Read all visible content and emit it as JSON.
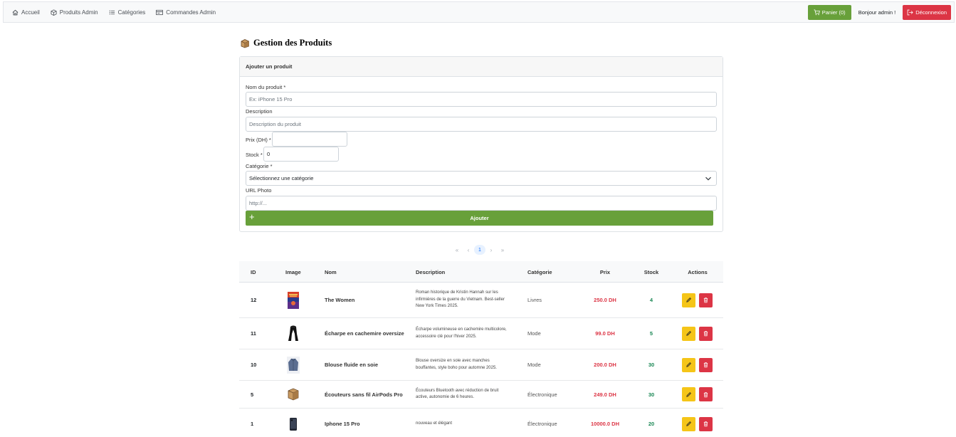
{
  "nav": {
    "home": "Accueil",
    "products_admin": "Produits Admin",
    "categories": "Catégories",
    "orders_admin": "Commandes Admin",
    "cart": "Panier (0)",
    "greeting": "Bonjour admin !",
    "logout": "Déconnexion"
  },
  "page": {
    "title": "Gestion des Produits"
  },
  "form": {
    "header": "Ajouter un produit",
    "name_label": "Nom du produit *",
    "name_placeholder": "Ex: iPhone 15 Pro",
    "desc_label": "Description",
    "desc_placeholder": "Description du produit",
    "price_label": "Prix (DH) *",
    "price_value": "",
    "stock_label": "Stock *",
    "stock_value": "0",
    "category_label": "Catégorie *",
    "category_selected": "Sélectionnez une catégorie",
    "photo_label": "URL Photo",
    "photo_placeholder": "http://...",
    "add_button": "Ajouter",
    "add_icon": "+"
  },
  "pagination": {
    "first": "«",
    "prev": "‹",
    "current": "1",
    "next": "›",
    "last": "»"
  },
  "table": {
    "headers": {
      "id": "ID",
      "image": "Image",
      "name": "Nom",
      "description": "Description",
      "category": "Catégorie",
      "price": "Prix",
      "stock": "Stock",
      "actions": "Actions"
    },
    "rows": [
      {
        "id": "12",
        "image_icon": "book-cover-icon",
        "name": "The Women",
        "description": "Roman historique de Kristin Hannah sur les infirmières de la guerre du Vietnam. Best-seller New York Times 2025.",
        "category": "Livres",
        "price": "250.0 DH",
        "stock": "4"
      },
      {
        "id": "11",
        "image_icon": "scarf-icon",
        "name": "Écharpe en cachemire oversize",
        "description": "Écharpe volumineuse en cachemire multicolore, accessoire clé pour l'hiver 2025.",
        "category": "Mode",
        "price": "99.0 DH",
        "stock": "5"
      },
      {
        "id": "10",
        "image_icon": "blouse-icon",
        "name": "Blouse fluide en soie",
        "description": "Blouse oversize en soie avec manches bouffantes, style boho pour automne 2025.",
        "category": "Mode",
        "price": "200.0 DH",
        "stock": "30"
      },
      {
        "id": "5",
        "image_icon": "box-icon",
        "name": "Écouteurs sans fil AirPods Pro",
        "description": "Écouteurs Bluetooth avec réduction de bruit active, autonomie de 6 heures.",
        "category": "Électronique",
        "price": "249.0 DH",
        "stock": "30"
      },
      {
        "id": "1",
        "image_icon": "phone-icon",
        "name": "Iphone 15 Pro",
        "description": "nouveau et élégant",
        "category": "Électronique",
        "price": "10000.0 DH",
        "stock": "20"
      }
    ]
  },
  "colors": {
    "success": "#68a03a",
    "danger": "#dc3545",
    "warning": "#f5c518",
    "stock_green": "#198754"
  }
}
